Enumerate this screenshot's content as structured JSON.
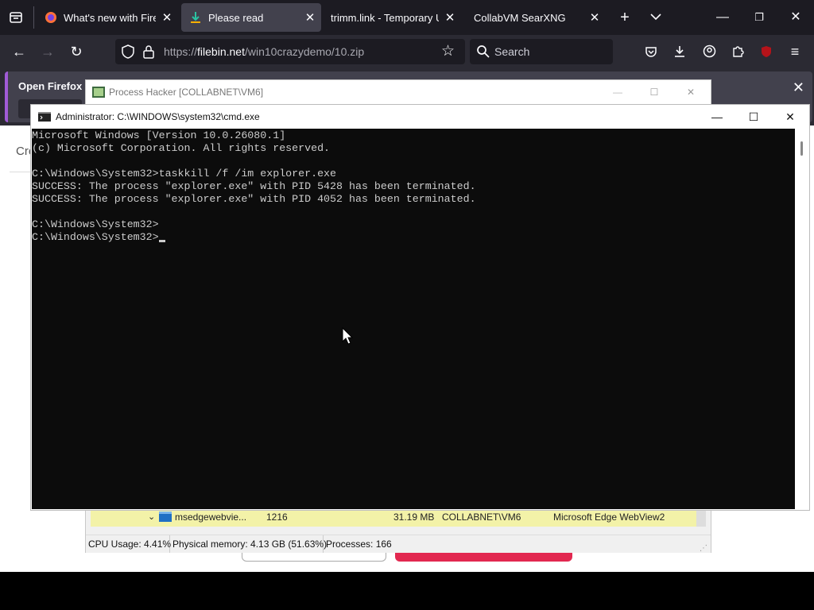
{
  "browser": {
    "tabs": [
      {
        "title": "What's new with Firefox",
        "active": false
      },
      {
        "title": "Please read",
        "active": true
      },
      {
        "title": "trimm.link - Temporary URL",
        "active": false
      },
      {
        "title": "CollabVM SearXNG",
        "active": false
      }
    ],
    "url": "https://filebin.net/win10crazydemo/10.zip",
    "url_domain": "filebin.net",
    "search_placeholder": "Search",
    "notification_text": "Open Firefox ev",
    "page_heading_fragment": "Cre"
  },
  "process_hacker": {
    "title": "Process Hacker [COLLABNET\\VM6]",
    "visible_row": {
      "name": "msedgewebvie...",
      "pid": "1216",
      "memory": "31.19 MB",
      "user": "COLLABNET\\VM6",
      "description": "Microsoft Edge WebView2"
    },
    "status": {
      "cpu": "CPU Usage: 4.41%",
      "memory": "Physical memory: 4.13 GB (51.63%)",
      "processes": "Processes: 166"
    }
  },
  "cmd": {
    "title": "Administrator: C:\\WINDOWS\\system32\\cmd.exe",
    "lines": [
      "Microsoft Windows [Version 10.0.26080.1]",
      "(c) Microsoft Corporation. All rights reserved.",
      "",
      "C:\\Windows\\System32>taskkill /f /im explorer.exe",
      "SUCCESS: The process \"explorer.exe\" with PID 5428 has been terminated.",
      "SUCCESS: The process \"explorer.exe\" with PID 4052 has been terminated.",
      "",
      "C:\\Windows\\System32>",
      "C:\\Windows\\System32>"
    ]
  },
  "colors": {
    "console_bg": "#0c0c0c",
    "console_text": "#cccccc",
    "firefox_dark": "#1c1b22",
    "row_highlight": "#f3f2a8",
    "page_button_red": "#e22850"
  }
}
